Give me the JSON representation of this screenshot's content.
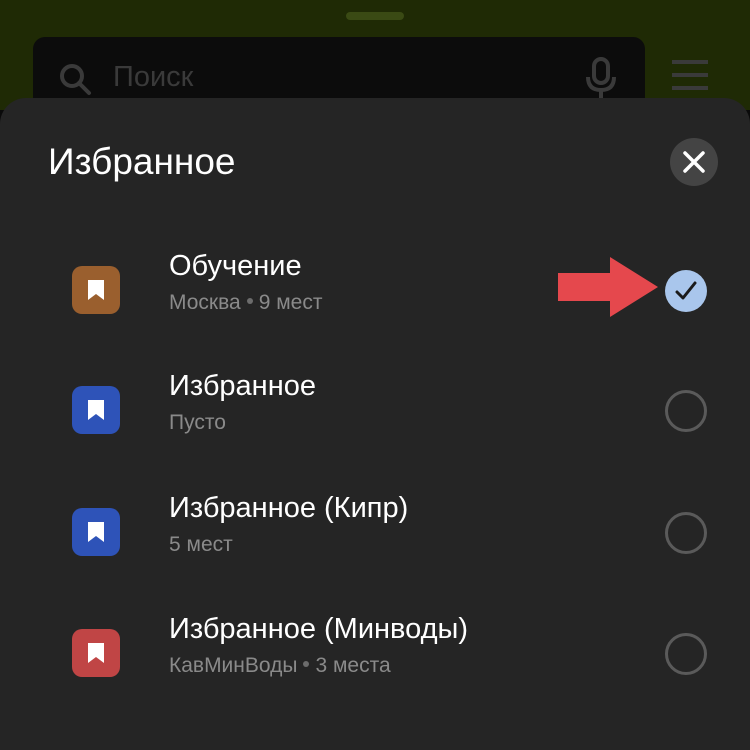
{
  "search": {
    "placeholder": "Поиск",
    "search_icon": "search-icon",
    "mic_icon": "mic-icon",
    "menu_icon": "menu-icon"
  },
  "sheet": {
    "title": "Избранное",
    "close_icon": "close-icon"
  },
  "lists": [
    {
      "title": "Обучение",
      "subtitle_parts": [
        "Москва",
        "9 мест"
      ],
      "icon": "bookmark-icon",
      "color": "#9a5f2e",
      "selected": true
    },
    {
      "title": "Избранное",
      "subtitle_parts": [
        "Пусто"
      ],
      "icon": "bookmark-icon",
      "color": "#2e53b8",
      "selected": false
    },
    {
      "title": "Избранное (Кипр)",
      "subtitle_parts": [
        "5 мест"
      ],
      "icon": "bookmark-icon",
      "color": "#2e53b8",
      "selected": false
    },
    {
      "title": "Избранное (Минводы)",
      "subtitle_parts": [
        "КавМинВоды",
        "3 места"
      ],
      "icon": "bookmark-icon",
      "color": "#c04545",
      "selected": false
    }
  ],
  "colors": {
    "sheet_bg": "#252525",
    "selected_radio": "#a9c6ec",
    "annotation_arrow": "#e5484d"
  }
}
